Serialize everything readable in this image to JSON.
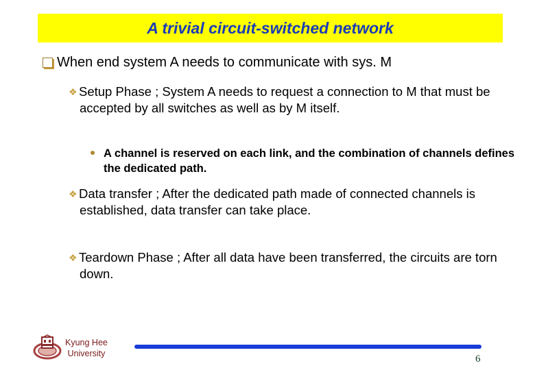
{
  "slide": {
    "title": "A trivial circuit-switched network",
    "bullets": [
      {
        "level": 1,
        "icon": "square-bullet-icon",
        "text": "When end system A needs to communicate with sys. M"
      },
      {
        "level": 2,
        "icon": "diamond-bullet-icon",
        "text": "Setup Phase ; System A needs to request a connection to M that must be accepted by all switches as well as by M itself."
      },
      {
        "level": 3,
        "icon": "dot-bullet-icon",
        "text": "A channel is reserved on each link, and the combination of channels defines the dedicated path."
      },
      {
        "level": 2,
        "icon": "diamond-bullet-icon",
        "text": "Data transfer ; After the dedicated path made of connected channels is established, data transfer can take place."
      },
      {
        "level": 2,
        "icon": "diamond-bullet-icon",
        "text": "Teardown Phase ; After all data have been transferred, the circuits are torn down."
      }
    ]
  },
  "footer": {
    "university_line1": "Kyung Hee",
    "university_line2": "University",
    "page_number": "6",
    "colors": {
      "title_bg": "#ffff00",
      "title_text": "#1a3cb8",
      "rule": "#1a3cd6",
      "university": "#7a1a1a"
    }
  }
}
